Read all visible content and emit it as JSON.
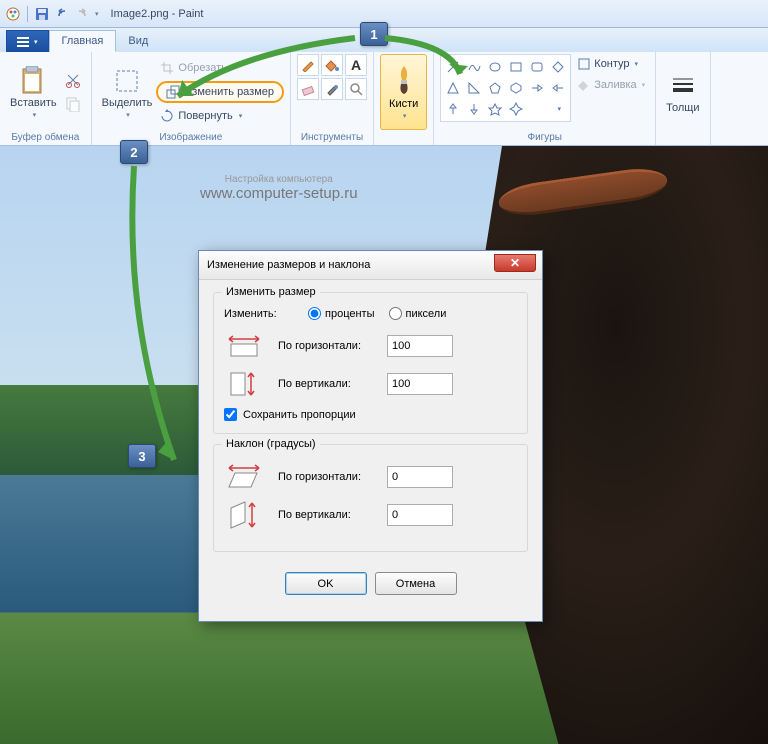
{
  "window": {
    "filename": "Image2.png",
    "app": "Paint"
  },
  "tabs": {
    "home": "Главная",
    "view": "Вид"
  },
  "ribbon": {
    "clipboard": {
      "paste": "Вставить",
      "label": "Буфер обмена"
    },
    "image": {
      "select": "Выделить",
      "crop": "Обрезать",
      "resize": "Изменить размер",
      "rotate": "Повернуть",
      "label": "Изображение"
    },
    "tools": {
      "label": "Инструменты"
    },
    "brushes": {
      "label": "Кисти"
    },
    "shapes": {
      "outline": "Контур",
      "fill": "Заливка",
      "label": "Фигуры"
    },
    "size": {
      "label": "Толщи"
    }
  },
  "watermark": {
    "top": "Настройка компьютера",
    "url": "www.computer-setup.ru"
  },
  "dialog": {
    "title": "Изменение размеров и наклона",
    "resize_legend": "Изменить размер",
    "by_label": "Изменить:",
    "percent": "проценты",
    "pixels": "пиксели",
    "horizontal": "По горизонтали:",
    "vertical": "По вертикали:",
    "h_value": "100",
    "v_value": "100",
    "aspect": "Сохранить пропорции",
    "skew_legend": "Наклон (градусы)",
    "skew_h": "0",
    "skew_v": "0",
    "ok": "OK",
    "cancel": "Отмена"
  },
  "badges": {
    "b1": "1",
    "b2": "2",
    "b3": "3"
  }
}
